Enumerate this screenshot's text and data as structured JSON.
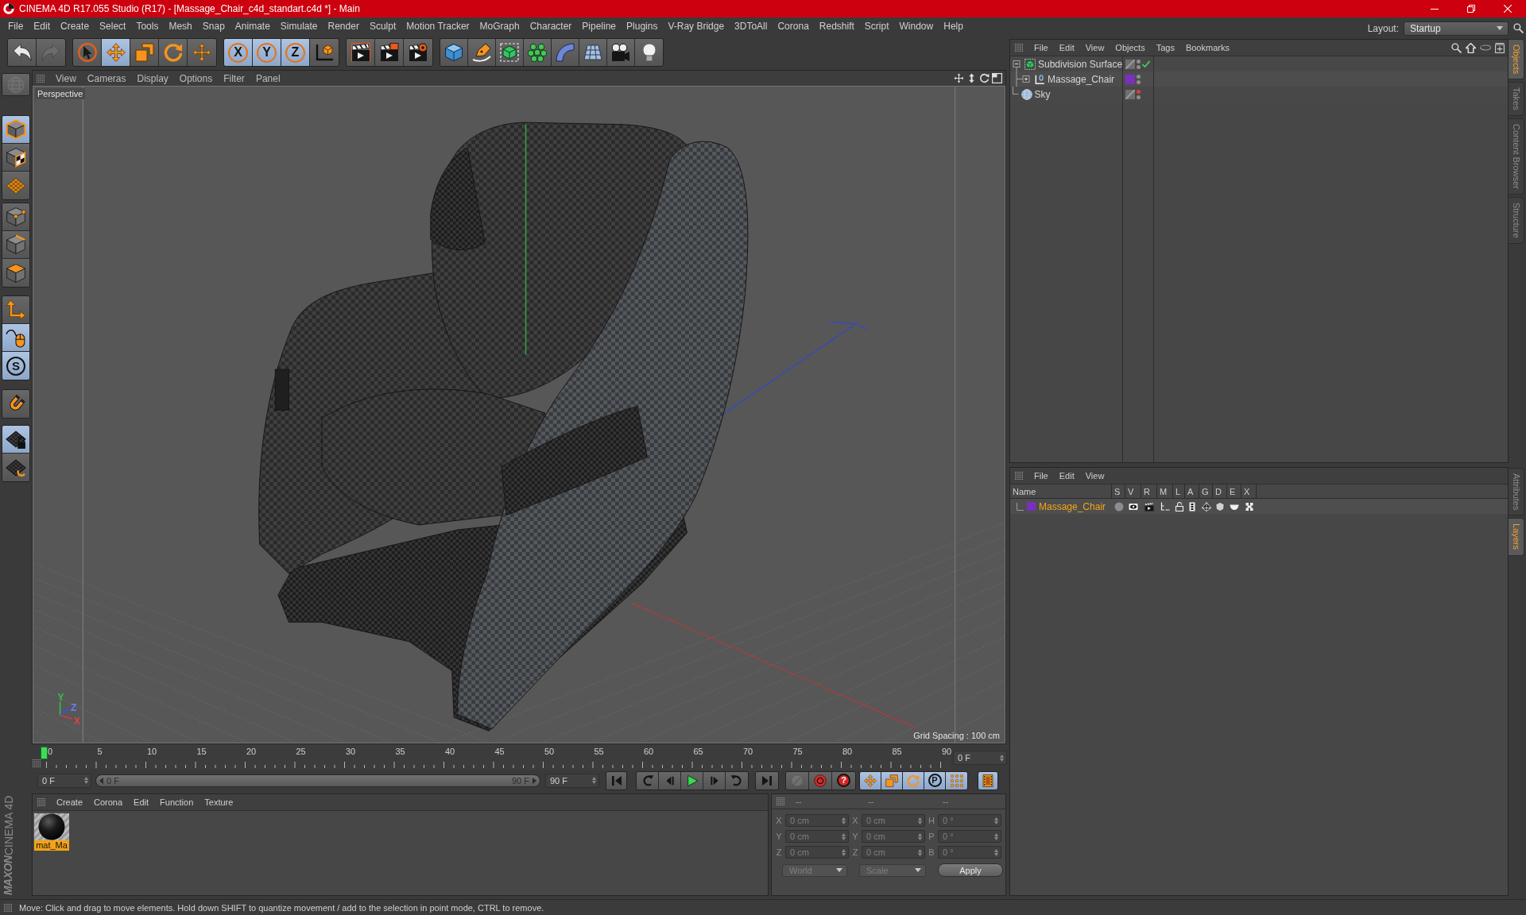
{
  "window": {
    "title": "CINEMA 4D R17.055 Studio (R17) - [Massage_Chair_c4d_standart.c4d *] - Main"
  },
  "menu_bar": [
    "File",
    "Edit",
    "Create",
    "Select",
    "Tools",
    "Mesh",
    "Snap",
    "Animate",
    "Simulate",
    "Render",
    "Sculpt",
    "Motion Tracker",
    "MoGraph",
    "Character",
    "Pipeline",
    "Plugins",
    "V-Ray Bridge",
    "3DToAll",
    "Corona",
    "Redshift",
    "Script",
    "Window",
    "Help"
  ],
  "layout": {
    "label": "Layout:",
    "value": "Startup"
  },
  "toolbar": {
    "groups": [
      [
        {
          "kind": "undo",
          "selected": false,
          "disabled": false
        },
        {
          "kind": "redo",
          "selected": false,
          "disabled": true
        }
      ],
      [
        {
          "kind": "select",
          "selected": false,
          "disabled": false
        },
        {
          "kind": "move",
          "selected": true,
          "disabled": false
        },
        {
          "kind": "scale",
          "selected": false,
          "disabled": false
        },
        {
          "kind": "rotate",
          "selected": false,
          "disabled": false
        },
        {
          "kind": "cross-move",
          "selected": false,
          "disabled": false
        }
      ],
      [
        {
          "kind": "axis",
          "label": "X",
          "selected": true,
          "disabled": false
        },
        {
          "kind": "axis",
          "label": "Y",
          "selected": true,
          "disabled": false
        },
        {
          "kind": "axis",
          "label": "Z",
          "selected": true,
          "disabled": false
        },
        {
          "kind": "coordinates",
          "selected": false,
          "disabled": false
        }
      ],
      [
        {
          "kind": "render-view",
          "selected": false,
          "disabled": false
        },
        {
          "kind": "render-picture",
          "selected": false,
          "disabled": false
        },
        {
          "kind": "render-settings",
          "selected": false,
          "disabled": false
        }
      ],
      [
        {
          "kind": "cube",
          "selected": false,
          "disabled": false
        },
        {
          "kind": "pen",
          "selected": false,
          "disabled": false
        },
        {
          "kind": "subdivision",
          "selected": false,
          "disabled": false
        },
        {
          "kind": "cloner",
          "selected": false,
          "disabled": false
        },
        {
          "kind": "deformer",
          "selected": false,
          "disabled": false
        },
        {
          "kind": "floor",
          "selected": false,
          "disabled": false
        },
        {
          "kind": "camera",
          "selected": false,
          "disabled": false
        },
        {
          "kind": "light",
          "selected": false,
          "disabled": false
        }
      ]
    ]
  },
  "mode_toolbar": {
    "groups": [
      [
        {
          "kind": "globe",
          "selected": false,
          "disabled": true
        }
      ],
      [
        {
          "kind": "model",
          "selected": true,
          "disabled": false
        },
        {
          "kind": "texture",
          "selected": false,
          "disabled": false
        },
        {
          "kind": "workplane",
          "selected": false,
          "disabled": false
        }
      ],
      [
        {
          "kind": "points",
          "selected": false,
          "disabled": false
        },
        {
          "kind": "edges",
          "selected": false,
          "disabled": false
        },
        {
          "kind": "polygons",
          "selected": false,
          "disabled": false
        }
      ],
      [
        {
          "kind": "axis-mode",
          "selected": false,
          "disabled": false
        },
        {
          "kind": "tweak",
          "selected": true,
          "disabled": false
        },
        {
          "kind": "snap",
          "label": "S",
          "selected": true,
          "disabled": false
        }
      ],
      [
        {
          "kind": "magnet",
          "selected": false,
          "disabled": false
        }
      ],
      [
        {
          "kind": "grid-lock",
          "selected": true,
          "disabled": false
        },
        {
          "kind": "grid-rotate",
          "selected": false,
          "disabled": false
        }
      ]
    ]
  },
  "viewport": {
    "menu": [
      "View",
      "Cameras",
      "Display",
      "Options",
      "Filter",
      "Panel"
    ],
    "camera": "Perspective",
    "axis_labels": [
      {
        "label": "Y",
        "color": "#36c048"
      },
      {
        "label": "Z",
        "color": "#6a7cff"
      },
      {
        "label": "X",
        "color": "#e04040"
      }
    ],
    "grid_spacing": "Grid Spacing : 100 cm"
  },
  "timeline": {
    "ticks": [
      "0",
      "5",
      "10",
      "15",
      "20",
      "25",
      "30",
      "35",
      "40",
      "45",
      "50",
      "55",
      "60",
      "65",
      "70",
      "75",
      "80",
      "85",
      "90"
    ],
    "level": 0,
    "frame": "0 F"
  },
  "playback": {
    "start": "0 F",
    "preview_range": {
      "start": "0 F",
      "end": "90 F",
      "level": 1
    },
    "end": "90 F",
    "groups": [
      [
        {
          "kind": "go-start",
          "selected": false,
          "disabled": false
        }
      ],
      [
        {
          "kind": "prev-key",
          "selected": false,
          "disabled": false
        },
        {
          "kind": "prev-frame",
          "selected": false,
          "disabled": false
        },
        {
          "kind": "play",
          "selected": false,
          "disabled": false
        },
        {
          "kind": "next-frame",
          "selected": false,
          "disabled": false
        },
        {
          "kind": "next-key",
          "selected": false,
          "disabled": false
        }
      ],
      [
        {
          "kind": "go-end",
          "selected": false,
          "disabled": false
        }
      ],
      [
        {
          "kind": "record-selection",
          "selected": false,
          "disabled": true
        },
        {
          "kind": "record",
          "selected": false,
          "disabled": false
        },
        {
          "kind": "autokey",
          "label": "?",
          "selected": false,
          "disabled": false
        }
      ],
      [
        {
          "kind": "key-move",
          "selected": true,
          "disabled": false
        },
        {
          "kind": "key-scale",
          "selected": true,
          "disabled": false
        },
        {
          "kind": "key-rotate",
          "selected": true,
          "disabled": false
        },
        {
          "kind": "key-param",
          "label": "P",
          "selected": true,
          "disabled": false
        },
        {
          "kind": "key-points",
          "selected": true,
          "disabled": false
        }
      ],
      [
        {
          "kind": "timeline",
          "selected": true,
          "disabled": false
        }
      ]
    ]
  },
  "material_manager": {
    "menu": [
      "Create",
      "Corona",
      "Edit",
      "Function",
      "Texture"
    ],
    "materials": [
      {
        "name": "mat_Ma",
        "selected": true
      }
    ]
  },
  "coordinates": {
    "disabled": true,
    "headers": [
      "--",
      "--",
      "--"
    ],
    "rows": [
      {
        "position_axis": "X",
        "position": "0 cm",
        "size_axis": "X",
        "size": "0 cm",
        "rotation_axis": "H",
        "rotation": "0 °"
      },
      {
        "position_axis": "Y",
        "position": "0 cm",
        "size_axis": "Y",
        "size": "0 cm",
        "rotation_axis": "P",
        "rotation": "0 °"
      },
      {
        "position_axis": "Z",
        "position": "0 cm",
        "size_axis": "Z",
        "size": "0 cm",
        "rotation_axis": "B",
        "rotation": "0 °"
      }
    ],
    "position_mode": "World",
    "size_mode": "Scale",
    "apply": "Apply"
  },
  "logo": {
    "brand": "MAXON",
    "product": "CINEMA 4D"
  },
  "status_bar": {
    "text": "Move: Click and drag to move elements. Hold down SHIFT to quantize movement / add to the selection in point mode, CTRL to remove."
  },
  "objects": {
    "menu": [
      "File",
      "Edit",
      "View",
      "Objects",
      "Tags",
      "Bookmarks"
    ],
    "tree": [
      {
        "name": "Subdivision Surface",
        "kind": "generator",
        "selected": false,
        "expanded": true,
        "enabled": true,
        "hidden_in_editor": false,
        "hidden_in_render": false,
        "children": [
          {
            "name": "Massage_Chair",
            "kind": "null",
            "selected": false,
            "expanded": false,
            "color": "#7b2fbe",
            "hidden_in_editor": false,
            "hidden_in_render": false
          }
        ]
      },
      {
        "name": "Sky",
        "kind": "sky",
        "selected": false,
        "hidden_in_editor": true,
        "hidden_in_render": false
      }
    ]
  },
  "layers": {
    "menu": [
      "File",
      "Edit",
      "View"
    ],
    "columns": [
      "Name",
      "S",
      "V",
      "R",
      "M",
      "L",
      "A",
      "G",
      "D",
      "E",
      "X"
    ],
    "rows": [
      {
        "name": "Massage_Chair",
        "color": "#7b2fbe",
        "selected": true,
        "flags": [
          false,
          true,
          true,
          true,
          false,
          true,
          true,
          true,
          true,
          true
        ]
      }
    ]
  },
  "side_tabs": {
    "top": [
      {
        "label": "Objects",
        "selected": true
      },
      {
        "label": "Takes",
        "selected": false
      },
      {
        "label": "Content Browser",
        "selected": false
      },
      {
        "label": "Structure",
        "selected": false
      }
    ],
    "bottom": [
      {
        "label": "Attributes",
        "selected": false
      },
      {
        "label": "Layers",
        "selected": true
      }
    ]
  }
}
